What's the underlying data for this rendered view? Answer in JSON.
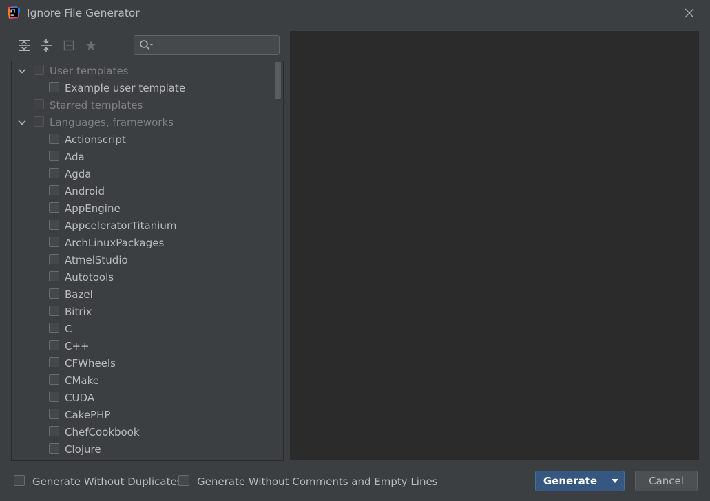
{
  "window": {
    "title": "Ignore File Generator",
    "app_icon": "intellij-idea-icon",
    "close_icon": "close-icon"
  },
  "toolbar": {
    "buttons": [
      {
        "name": "expand-all-button",
        "icon": "expand-all-icon"
      },
      {
        "name": "collapse-all-button",
        "icon": "collapse-all-icon"
      },
      {
        "name": "unselect-all-button",
        "icon": "unselect-all-icon"
      },
      {
        "name": "starred-button",
        "icon": "star-icon"
      }
    ],
    "search": {
      "value": "",
      "placeholder": "",
      "icon": "search-icon"
    }
  },
  "tree": {
    "groups": [
      {
        "label": "User templates",
        "expanded": true,
        "children": [
          "Example user template"
        ]
      },
      {
        "label": "Starred templates",
        "expanded": false,
        "children": []
      },
      {
        "label": "Languages, frameworks",
        "expanded": true,
        "children": [
          "Actionscript",
          "Ada",
          "Agda",
          "Android",
          "AppEngine",
          "AppceleratorTitanium",
          "ArchLinuxPackages",
          "AtmelStudio",
          "Autotools",
          "Bazel",
          "Bitrix",
          "C",
          "C++",
          "CFWheels",
          "CMake",
          "CUDA",
          "CakePHP",
          "ChefCookbook",
          "Clojure"
        ]
      }
    ]
  },
  "options": {
    "without_duplicates": "Generate Without Duplicates",
    "without_comments": "Generate Without Comments and Empty Lines"
  },
  "buttons": {
    "generate": "Generate",
    "cancel": "Cancel"
  },
  "colors": {
    "background": "#3c3f41",
    "preview_background": "#2b2b2b",
    "primary_button": "#365880",
    "text": "#bbbbbb"
  }
}
